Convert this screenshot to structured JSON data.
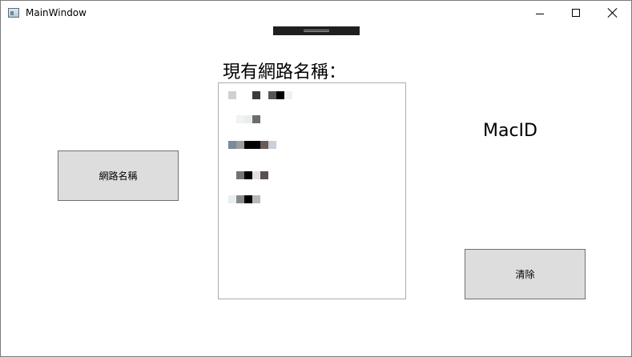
{
  "window": {
    "title": "MainWindow",
    "icon": "app-window-icon"
  },
  "title_controls": {
    "minimize": "minimize-icon",
    "maximize": "maximize-icon",
    "close": "close-icon"
  },
  "main": {
    "heading": "現有網路名稱：",
    "network_list": {
      "items": [
        "",
        "",
        "",
        "",
        ""
      ],
      "note_pixelated": true
    },
    "macid_label": "MacID",
    "network_name_button": "網路名稱",
    "clear_button": "清除"
  },
  "colors": {
    "button_bg": "#dddddd",
    "button_border": "#707070",
    "list_border": "#abadb3",
    "debug_bar": "#1f1f1f"
  }
}
